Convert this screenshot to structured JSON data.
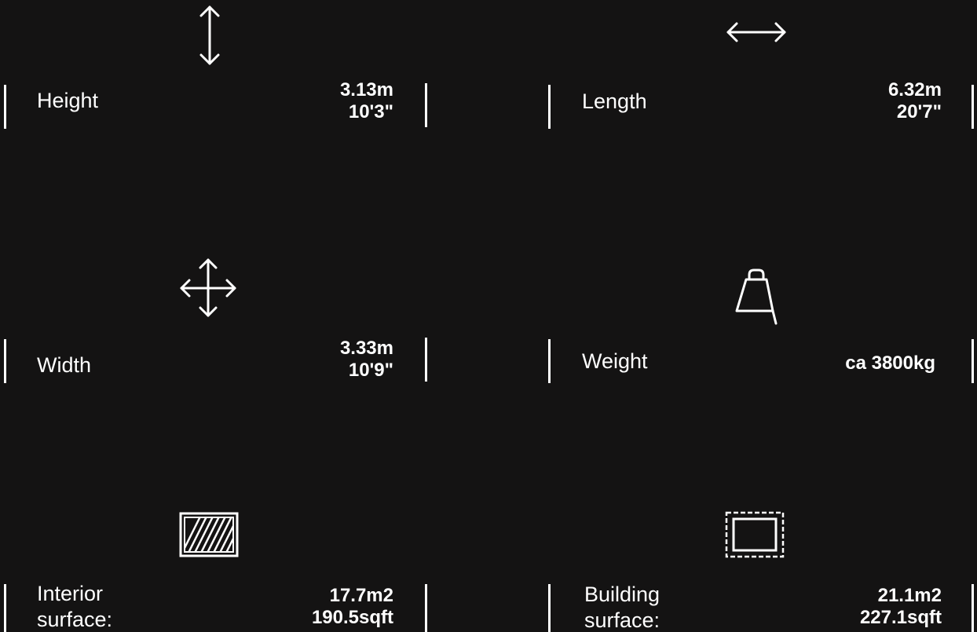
{
  "specs": [
    {
      "id": "height",
      "label": "Height",
      "value_metric": "3.13m",
      "value_imperial": "10'3\"",
      "icon": "vertical-arrows-icon"
    },
    {
      "id": "length",
      "label": "Length",
      "value_metric": "6.32m",
      "value_imperial": "20'7\"",
      "icon": "horizontal-arrows-icon"
    },
    {
      "id": "width",
      "label": "Width",
      "value_metric": "3.33m",
      "value_imperial": "10'9\"",
      "icon": "move-arrows-icon"
    },
    {
      "id": "weight",
      "label": "Weight",
      "value": "ca 3800kg",
      "icon": "weight-icon"
    },
    {
      "id": "interior-surface",
      "label_line1": "Interior",
      "label_line2": "surface:",
      "value_metric": "17.7m2",
      "value_imperial": "190.5sqft",
      "icon": "hatched-area-icon"
    },
    {
      "id": "building-surface",
      "label_line1": "Building",
      "label_line2": "surface:",
      "value_metric": "21.1m2",
      "value_imperial": "227.1sqft",
      "icon": "building-outline-icon"
    }
  ],
  "colors": {
    "background": "#141313",
    "foreground": "#ffffff"
  }
}
